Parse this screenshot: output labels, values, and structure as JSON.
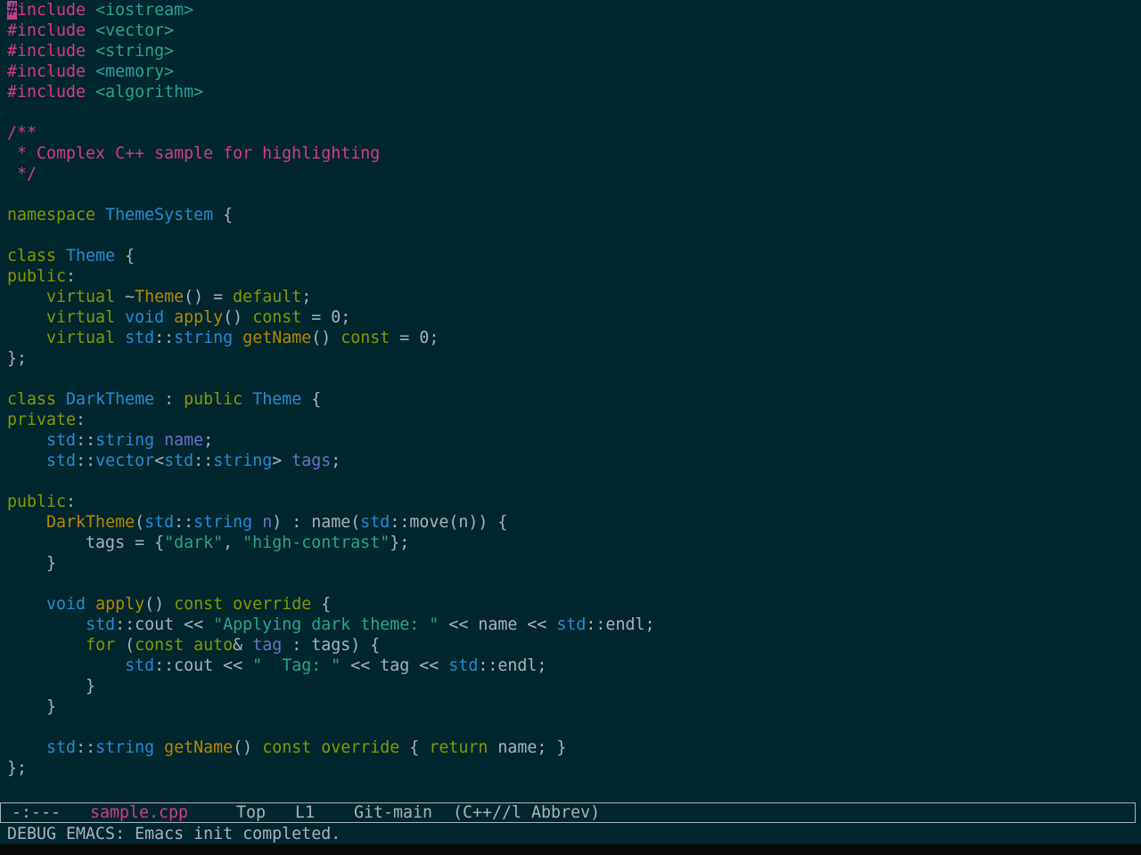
{
  "editor": {
    "lines": [
      {
        "tokens": [
          [
            "cursor",
            "#"
          ],
          [
            "tok-pre",
            "include "
          ],
          [
            "tok-inc",
            "<iostream>"
          ]
        ]
      },
      {
        "tokens": [
          [
            "tok-pre",
            "#include "
          ],
          [
            "tok-inc",
            "<vector>"
          ]
        ]
      },
      {
        "tokens": [
          [
            "tok-pre",
            "#include "
          ],
          [
            "tok-inc",
            "<string>"
          ]
        ]
      },
      {
        "tokens": [
          [
            "tok-pre",
            "#include "
          ],
          [
            "tok-inc",
            "<memory>"
          ]
        ]
      },
      {
        "tokens": [
          [
            "tok-pre",
            "#include "
          ],
          [
            "tok-inc",
            "<algorithm>"
          ]
        ]
      },
      {
        "tokens": []
      },
      {
        "tokens": [
          [
            "tok-cmt",
            "/**"
          ]
        ]
      },
      {
        "tokens": [
          [
            "tok-cmt",
            " * Complex C++ sample for highlighting"
          ]
        ]
      },
      {
        "tokens": [
          [
            "tok-cmt",
            " */"
          ]
        ]
      },
      {
        "tokens": []
      },
      {
        "tokens": [
          [
            "tok-kw",
            "namespace "
          ],
          [
            "tok-type",
            "ThemeSystem"
          ],
          [
            "tok-punc",
            " {"
          ]
        ]
      },
      {
        "tokens": []
      },
      {
        "tokens": [
          [
            "tok-kw",
            "class "
          ],
          [
            "tok-type",
            "Theme"
          ],
          [
            "tok-punc",
            " {"
          ]
        ]
      },
      {
        "tokens": [
          [
            "tok-kw",
            "public"
          ],
          [
            "tok-punc",
            ":"
          ]
        ]
      },
      {
        "tokens": [
          [
            "tok-punc",
            "    "
          ],
          [
            "tok-kw",
            "virtual "
          ],
          [
            "tok-punc",
            "~"
          ],
          [
            "tok-fn",
            "Theme"
          ],
          [
            "tok-punc",
            "() = "
          ],
          [
            "tok-kw",
            "default"
          ],
          [
            "tok-punc",
            ";"
          ]
        ]
      },
      {
        "tokens": [
          [
            "tok-punc",
            "    "
          ],
          [
            "tok-kw",
            "virtual "
          ],
          [
            "tok-type",
            "void "
          ],
          [
            "tok-fn",
            "apply"
          ],
          [
            "tok-punc",
            "() "
          ],
          [
            "tok-kw",
            "const"
          ],
          [
            "tok-punc",
            " = 0;"
          ]
        ]
      },
      {
        "tokens": [
          [
            "tok-punc",
            "    "
          ],
          [
            "tok-kw",
            "virtual "
          ],
          [
            "tok-type",
            "std"
          ],
          [
            "tok-punc",
            "::"
          ],
          [
            "tok-type",
            "string "
          ],
          [
            "tok-fn",
            "getName"
          ],
          [
            "tok-punc",
            "() "
          ],
          [
            "tok-kw",
            "const"
          ],
          [
            "tok-punc",
            " = 0;"
          ]
        ]
      },
      {
        "tokens": [
          [
            "tok-punc",
            "};"
          ]
        ]
      },
      {
        "tokens": []
      },
      {
        "tokens": [
          [
            "tok-kw",
            "class "
          ],
          [
            "tok-type",
            "DarkTheme"
          ],
          [
            "tok-punc",
            " : "
          ],
          [
            "tok-kw",
            "public "
          ],
          [
            "tok-type",
            "Theme"
          ],
          [
            "tok-punc",
            " {"
          ]
        ]
      },
      {
        "tokens": [
          [
            "tok-kw",
            "private"
          ],
          [
            "tok-punc",
            ":"
          ]
        ]
      },
      {
        "tokens": [
          [
            "tok-punc",
            "    "
          ],
          [
            "tok-type",
            "std"
          ],
          [
            "tok-punc",
            "::"
          ],
          [
            "tok-type",
            "string "
          ],
          [
            "tok-var",
            "name"
          ],
          [
            "tok-punc",
            ";"
          ]
        ]
      },
      {
        "tokens": [
          [
            "tok-punc",
            "    "
          ],
          [
            "tok-type",
            "std"
          ],
          [
            "tok-punc",
            "::"
          ],
          [
            "tok-type",
            "vector"
          ],
          [
            "tok-punc",
            "<"
          ],
          [
            "tok-type",
            "std"
          ],
          [
            "tok-punc",
            "::"
          ],
          [
            "tok-type",
            "string"
          ],
          [
            "tok-punc",
            "> "
          ],
          [
            "tok-var",
            "tags"
          ],
          [
            "tok-punc",
            ";"
          ]
        ]
      },
      {
        "tokens": []
      },
      {
        "tokens": [
          [
            "tok-kw",
            "public"
          ],
          [
            "tok-punc",
            ":"
          ]
        ]
      },
      {
        "tokens": [
          [
            "tok-punc",
            "    "
          ],
          [
            "tok-fn",
            "DarkTheme"
          ],
          [
            "tok-punc",
            "("
          ],
          [
            "tok-type",
            "std"
          ],
          [
            "tok-punc",
            "::"
          ],
          [
            "tok-type",
            "string "
          ],
          [
            "tok-var",
            "n"
          ],
          [
            "tok-punc",
            ") : name("
          ],
          [
            "tok-type",
            "std"
          ],
          [
            "tok-punc",
            "::move(n)) {"
          ]
        ]
      },
      {
        "tokens": [
          [
            "tok-punc",
            "        tags = {"
          ],
          [
            "tok-str",
            "\"dark\""
          ],
          [
            "tok-punc",
            ", "
          ],
          [
            "tok-str",
            "\"high-contrast\""
          ],
          [
            "tok-punc",
            "};"
          ]
        ]
      },
      {
        "tokens": [
          [
            "tok-punc",
            "    }"
          ]
        ]
      },
      {
        "tokens": []
      },
      {
        "tokens": [
          [
            "tok-punc",
            "    "
          ],
          [
            "tok-type",
            "void "
          ],
          [
            "tok-fn",
            "apply"
          ],
          [
            "tok-punc",
            "() "
          ],
          [
            "tok-kw",
            "const override"
          ],
          [
            "tok-punc",
            " {"
          ]
        ]
      },
      {
        "tokens": [
          [
            "tok-punc",
            "        "
          ],
          [
            "tok-type",
            "std"
          ],
          [
            "tok-punc",
            "::cout << "
          ],
          [
            "tok-str",
            "\"Applying dark theme: \""
          ],
          [
            "tok-punc",
            " << name << "
          ],
          [
            "tok-type",
            "std"
          ],
          [
            "tok-punc",
            "::endl;"
          ]
        ]
      },
      {
        "tokens": [
          [
            "tok-punc",
            "        "
          ],
          [
            "tok-kw",
            "for"
          ],
          [
            "tok-punc",
            " ("
          ],
          [
            "tok-kw",
            "const auto"
          ],
          [
            "tok-punc",
            "& "
          ],
          [
            "tok-var",
            "tag"
          ],
          [
            "tok-punc",
            " : tags) {"
          ]
        ]
      },
      {
        "tokens": [
          [
            "tok-punc",
            "            "
          ],
          [
            "tok-type",
            "std"
          ],
          [
            "tok-punc",
            "::cout << "
          ],
          [
            "tok-str",
            "\"  Tag: \""
          ],
          [
            "tok-punc",
            " << tag << "
          ],
          [
            "tok-type",
            "std"
          ],
          [
            "tok-punc",
            "::endl;"
          ]
        ]
      },
      {
        "tokens": [
          [
            "tok-punc",
            "        }"
          ]
        ]
      },
      {
        "tokens": [
          [
            "tok-punc",
            "    }"
          ]
        ]
      },
      {
        "tokens": []
      },
      {
        "tokens": [
          [
            "tok-punc",
            "    "
          ],
          [
            "tok-type",
            "std"
          ],
          [
            "tok-punc",
            "::"
          ],
          [
            "tok-type",
            "string "
          ],
          [
            "tok-fn",
            "getName"
          ],
          [
            "tok-punc",
            "() "
          ],
          [
            "tok-kw",
            "const override"
          ],
          [
            "tok-punc",
            " { "
          ],
          [
            "tok-kw",
            "return"
          ],
          [
            "tok-punc",
            " name; }"
          ]
        ]
      },
      {
        "tokens": [
          [
            "tok-punc",
            "};"
          ]
        ]
      }
    ]
  },
  "modeline": {
    "status": "-:---",
    "buffer_name": "sample.cpp",
    "position": "Top",
    "line": "L1",
    "vc": "Git-main",
    "modes": "(C++//l Abbrev)"
  },
  "echo_area": {
    "message": "DEBUG EMACS: Emacs init completed."
  },
  "colors": {
    "background": "#00262e",
    "preprocessor": "#d23d88",
    "keyword": "#859900",
    "type": "#268bd2",
    "function": "#b58900",
    "variable": "#6c71c4",
    "string": "#2aa198",
    "default_text": "#a7b4b8"
  }
}
